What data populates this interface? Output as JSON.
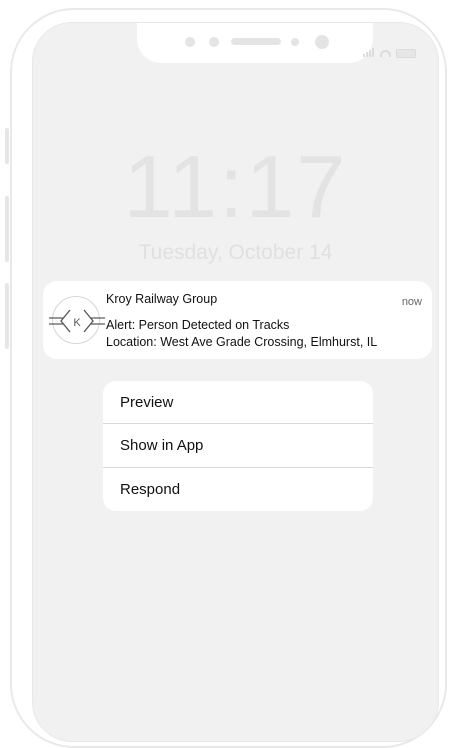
{
  "lock_screen": {
    "time": "11:17",
    "date": "Tuesday, October 14"
  },
  "status_bar": {
    "icons": [
      "cellular-signal-icon",
      "wifi-icon",
      "battery-icon"
    ]
  },
  "notification": {
    "app_name": "Kroy Railway Group",
    "timestamp": "now",
    "logo_letter": "K",
    "line1": "Alert: Person Detected on Tracks",
    "line2": "Location: West Ave Grade Crossing, Elmhurst, IL"
  },
  "action_menu": {
    "items": [
      {
        "label": "Preview"
      },
      {
        "label": "Show in App"
      },
      {
        "label": "Respond"
      }
    ]
  },
  "colors": {
    "screen_bg": "#f1f1f1",
    "card_bg": "#ffffff",
    "faded_text": "#e3e3e4"
  }
}
